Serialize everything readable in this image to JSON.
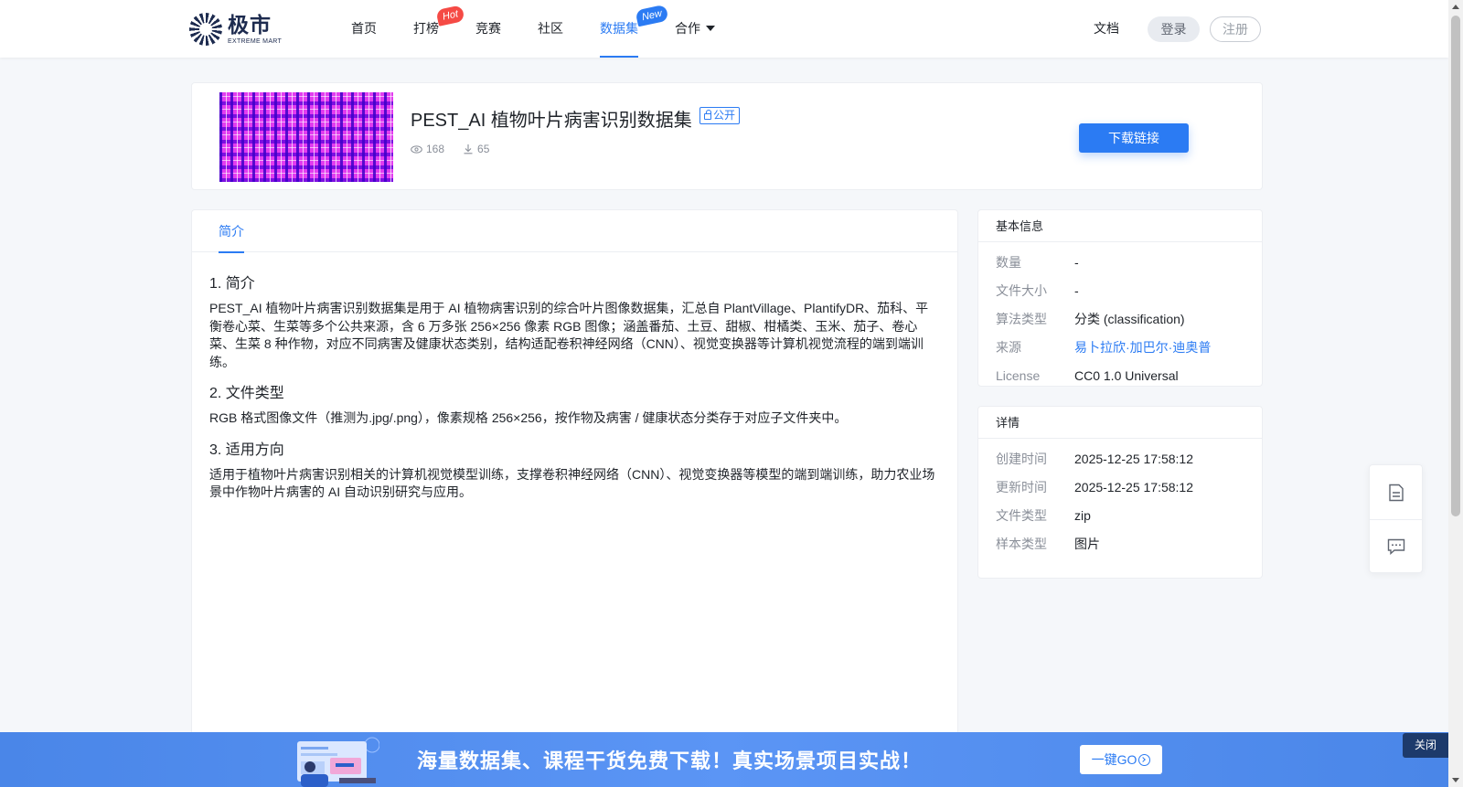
{
  "header": {
    "logo_cn": "极市",
    "logo_en": "EXTREME MART",
    "nav": [
      {
        "label": "首页"
      },
      {
        "label": "打榜",
        "badge": "Hot"
      },
      {
        "label": "竞赛"
      },
      {
        "label": "社区"
      },
      {
        "label": "数据集",
        "badge": "New",
        "active": true
      },
      {
        "label": "合作"
      }
    ],
    "doc_label": "文档",
    "login_label": "登录",
    "register_label": "注册"
  },
  "dataset": {
    "title": "PEST_AI 植物叶片病害识别数据集",
    "visibility": "公开",
    "views": "168",
    "downloads": "65",
    "download_button": "下载链接"
  },
  "main": {
    "tab_label": "简介",
    "sections": [
      {
        "heading": "1. 简介",
        "body": "PEST_AI 植物叶片病害识别数据集是用于 AI 植物病害识别的综合叶片图像数据集，汇总自 PlantVillage、PlantifyDR、茄科、平衡卷心菜、生菜等多个公共来源，含 6 万多张 256×256 像素 RGB 图像；涵盖番茄、土豆、甜椒、柑橘类、玉米、茄子、卷心菜、生菜 8 种作物，对应不同病害及健康状态类别，结构适配卷积神经网络（CNN）、视觉变换器等计算机视觉流程的端到端训练。"
      },
      {
        "heading": "2. 文件类型",
        "body": "RGB 格式图像文件（推测为.jpg/.png），像素规格 256×256，按作物及病害 / 健康状态分类存于对应子文件夹中。"
      },
      {
        "heading": "3. 适用方向",
        "body": "适用于植物叶片病害识别相关的计算机视觉模型训练，支撑卷积神经网络（CNN）、视觉变换器等模型的端到端训练，助力农业场景中作物叶片病害的 AI 自动识别研究与应用。"
      }
    ]
  },
  "basic_info": {
    "title": "基本信息",
    "rows": [
      {
        "key": "数量",
        "value": "-"
      },
      {
        "key": "文件大小",
        "value": "-"
      },
      {
        "key": "算法类型",
        "value": "分类 (classification)"
      },
      {
        "key": "来源",
        "value": "易卜拉欣·加巴尔·迪奥普"
      },
      {
        "key": "License",
        "value": "CC0 1.0 Universal"
      }
    ]
  },
  "details": {
    "title": "详情",
    "rows": [
      {
        "key": "创建时间",
        "value": "2025-12-25 17:58:12"
      },
      {
        "key": "更新时间",
        "value": "2025-12-25 17:58:12"
      },
      {
        "key": "文件类型",
        "value": "zip"
      },
      {
        "key": "样本类型",
        "value": "图片"
      }
    ]
  },
  "banner": {
    "text": "海量数据集、课程干货免费下载！真实场景项目实战！",
    "button": "一键GO",
    "close": "关闭"
  },
  "icons": [
    "eye-icon",
    "download-icon",
    "lock-icon",
    "document-icon",
    "chat-icon",
    "caret-down-icon"
  ],
  "colors": {
    "accent": "#2b7bf3",
    "hot": "#f54a45",
    "banner": "#4a86e8"
  }
}
